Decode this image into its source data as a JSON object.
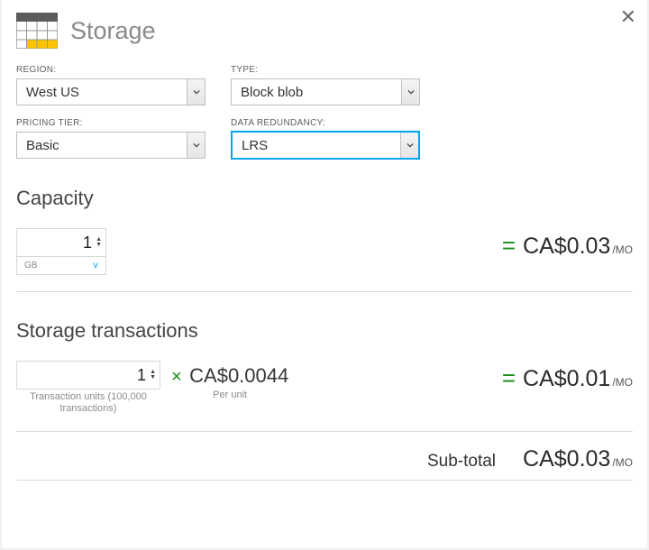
{
  "title": "Storage",
  "fields": {
    "region": {
      "label": "REGION:",
      "value": "West US"
    },
    "type": {
      "label": "TYPE:",
      "value": "Block blob"
    },
    "tier": {
      "label": "PRICING TIER:",
      "value": "Basic"
    },
    "redundancy": {
      "label": "DATA REDUNDANCY:",
      "value": "LRS"
    }
  },
  "capacity": {
    "heading": "Capacity",
    "value": "1",
    "unit": "GB",
    "price": "CA$0.03",
    "price_unit": "/MO"
  },
  "transactions": {
    "heading": "Storage transactions",
    "value": "1",
    "caption_line1": "Transaction units (100,000",
    "caption_line2": "transactions)",
    "per_unit_price": "CA$0.0044",
    "per_unit_label": "Per unit",
    "price": "CA$0.01",
    "price_unit": "/MO"
  },
  "subtotal": {
    "label": "Sub-total",
    "price": "CA$0.03",
    "price_unit": "/MO"
  }
}
